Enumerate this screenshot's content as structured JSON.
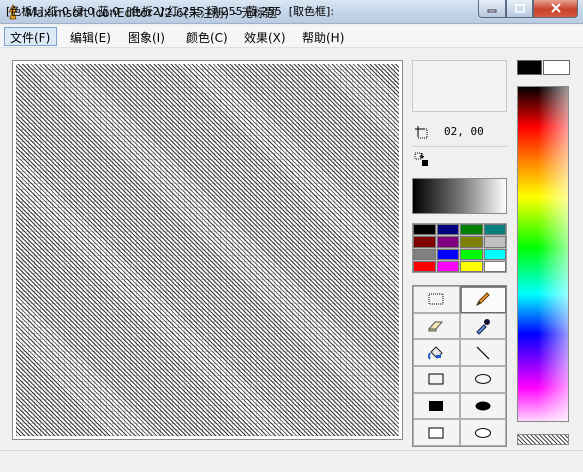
{
  "window": {
    "title": "Maximsoft IconEditor V2.6(未注册) - 无标题",
    "icons": {
      "app": "lamp-icon",
      "min": "minimize-icon",
      "max": "maximize-icon",
      "close": "close-icon"
    }
  },
  "menu": {
    "items": [
      {
        "label": "文件(F)"
      },
      {
        "label": "编辑(E)"
      },
      {
        "label": "图象(I)"
      },
      {
        "label": "颜色(C)"
      },
      {
        "label": "效果(X)"
      },
      {
        "label": "帮助(H)"
      }
    ]
  },
  "panel": {
    "coords": "02, 00",
    "palette": [
      "#000000",
      "#000080",
      "#008000",
      "#008080",
      "#800000",
      "#800080",
      "#808000",
      "#c0c0c0",
      "#808080",
      "#0000ff",
      "#00ff00",
      "#00ffff",
      "#ff0000",
      "#ff00ff",
      "#ffff00",
      "#ffffff"
    ],
    "tools": [
      "rect-select-icon",
      "pencil-icon",
      "eraser-icon",
      "eyedropper-icon",
      "fill-bucket-icon",
      "line-icon",
      "rectangle-outline-icon",
      "ellipse-outline-icon",
      "rectangle-filled-icon",
      "ellipse-filled-icon",
      "rect-icon",
      "ellipse-icon"
    ]
  },
  "colors": {
    "foreground": "#000000",
    "background": "#ffffff"
  },
  "status": {
    "text": "[色板1]:红:0 绿:0 蓝:0  [色板2]:红:255 绿:255 蓝:255  [取色框]:"
  }
}
